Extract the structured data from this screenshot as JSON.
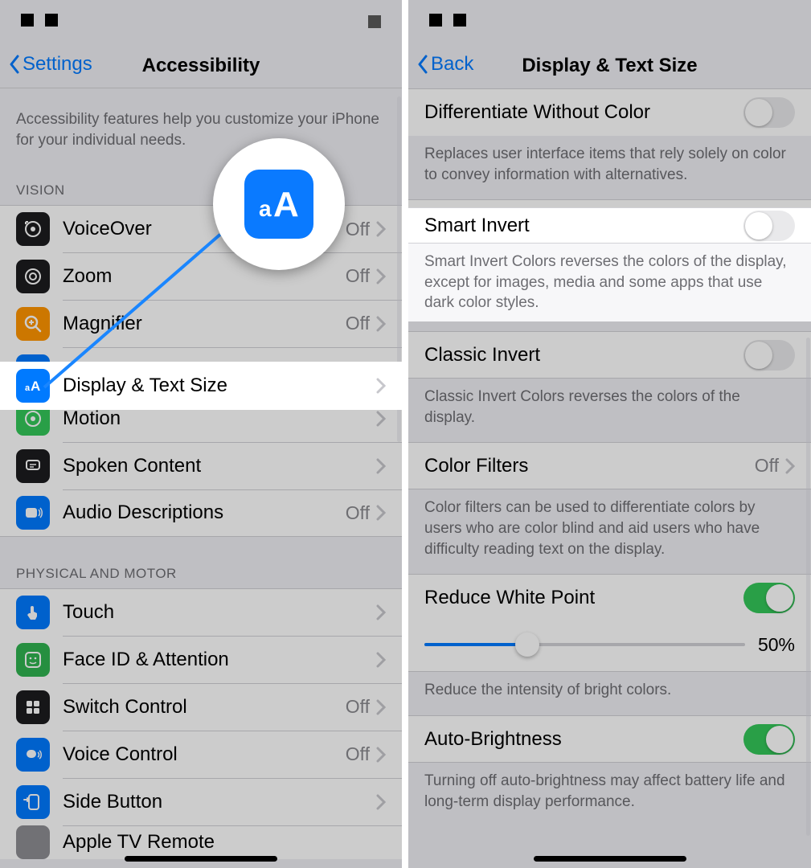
{
  "left": {
    "back_label": "Settings",
    "title": "Accessibility",
    "intro": "Accessibility features help you customize your iPhone for your individual needs.",
    "section_vision": "VISION",
    "vision": [
      {
        "label": "VoiceOver",
        "value": "Off",
        "chev": true
      },
      {
        "label": "Zoom",
        "value": "Off",
        "chev": true
      },
      {
        "label": "Magnifier",
        "value": "Off",
        "chev": true
      },
      {
        "label": "Display & Text Size",
        "value": "",
        "chev": true
      },
      {
        "label": "Motion",
        "value": "",
        "chev": true
      },
      {
        "label": "Spoken Content",
        "value": "",
        "chev": true
      },
      {
        "label": "Audio Descriptions",
        "value": "Off",
        "chev": true
      }
    ],
    "section_motor": "PHYSICAL AND MOTOR",
    "motor": [
      {
        "label": "Touch",
        "value": "",
        "chev": true
      },
      {
        "label": "Face ID & Attention",
        "value": "",
        "chev": true
      },
      {
        "label": "Switch Control",
        "value": "Off",
        "chev": true
      },
      {
        "label": "Voice Control",
        "value": "Off",
        "chev": true
      },
      {
        "label": "Side Button",
        "value": "",
        "chev": true
      },
      {
        "label": "Apple TV Remote",
        "value": "",
        "chev": true
      }
    ]
  },
  "right": {
    "back_label": "Back",
    "title": "Display & Text Size",
    "items": {
      "diff_color": {
        "label": "Differentiate Without Color",
        "on": false,
        "foot": "Replaces user interface items that rely solely on color to convey information with alternatives."
      },
      "smart_invert": {
        "label": "Smart Invert",
        "on": false,
        "foot": "Smart Invert Colors reverses the colors of the display, except for images, media and some apps that use dark color styles."
      },
      "classic_invert": {
        "label": "Classic Invert",
        "on": false,
        "foot": "Classic Invert Colors reverses the colors of the display."
      },
      "color_filters": {
        "label": "Color Filters",
        "value": "Off",
        "foot": "Color filters can be used to differentiate colors by users who are color blind and aid users who have difficulty reading text on the display."
      },
      "reduce_white": {
        "label": "Reduce White Point",
        "on": true,
        "percent": "50%",
        "percent_num": 50,
        "foot": "Reduce the intensity of bright colors."
      },
      "auto_bright": {
        "label": "Auto-Brightness",
        "on": true,
        "foot": "Turning off auto-brightness may affect battery life and long-term display performance."
      }
    }
  }
}
